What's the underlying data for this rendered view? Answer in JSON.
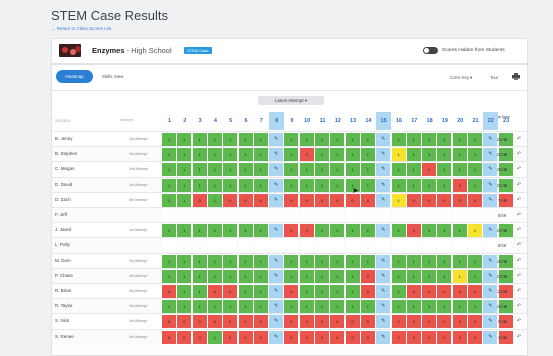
{
  "page": {
    "title": "STEM Case Results",
    "back_link": "← Return to Class Scores List"
  },
  "case": {
    "name": "Enzymes",
    "level": " - High School",
    "badge": "STEM Case"
  },
  "toggle_label": "Scores Hidden from Students",
  "tabs": [
    {
      "label": "Heatmap",
      "active": true
    },
    {
      "label": "Skills View",
      "active": false
    }
  ],
  "controls": {
    "color_key": "Color Key ▾",
    "tour": "Tour"
  },
  "attempt_select": "Latest Attempt ▾",
  "table": {
    "date": "2/1/2021",
    "attempts_header": "Attempts",
    "total_score_header": "Total Score",
    "questions": [
      "1",
      "2",
      "3",
      "4",
      "5",
      "6",
      "7",
      "8",
      "9",
      "10",
      "11",
      "12",
      "13",
      "14",
      "15",
      "16",
      "17",
      "18",
      "19",
      "20",
      "21",
      "22",
      "23"
    ],
    "rows": [
      {
        "name": "B. Jenny",
        "attempt": "3rd Attempt",
        "score": "26/49"
      },
      {
        "name": "B. Stephen",
        "attempt": "3rd Attempt",
        "score": "23/49"
      },
      {
        "name": "C. Megan",
        "attempt": "2nd Attempt",
        "score": "25/49"
      },
      {
        "name": "D. David",
        "attempt": "3rd Attempt",
        "score": "22/49"
      },
      {
        "name": "D. Zach",
        "attempt": "4th Attempt",
        "score": "7/49"
      },
      {
        "name": "F. Jeff",
        "attempt": "",
        "score": "0/49"
      },
      {
        "name": "J. Jared",
        "attempt": "1st Attempt",
        "score": "20/49"
      },
      {
        "name": "L. Polly",
        "attempt": "",
        "score": "0/49"
      },
      {
        "name": "M. Dom",
        "attempt": "3rd Attempt",
        "score": "26/49"
      },
      {
        "name": "P. Chase",
        "attempt": "3rd Attempt",
        "score": "24/49"
      },
      {
        "name": "R. Brian",
        "attempt": "4th Attempt",
        "score": "11/49"
      },
      {
        "name": "R. Taylor",
        "attempt": "3rd Attempt",
        "score": "26/49"
      },
      {
        "name": "S. Nick",
        "attempt": "3rd Attempt",
        "score": "0/49"
      },
      {
        "name": "S. Renee",
        "attempt": "4th Attempt",
        "score": "3/49"
      }
    ],
    "pencil_cols": [
      7,
      14,
      21
    ],
    "cells": [
      [
        "G",
        "G",
        "G",
        "G",
        "G",
        "G",
        "G",
        "P",
        "G",
        "G",
        "G",
        "G",
        "G",
        "G",
        "P",
        "G",
        "G",
        "G",
        "G",
        "G",
        "G",
        "P",
        "G"
      ],
      [
        "G",
        "G",
        "G",
        "G",
        "G",
        "G",
        "G",
        "P",
        "G",
        "R",
        "G",
        "G",
        "G",
        "G",
        "P",
        "Y",
        "G",
        "G",
        "G",
        "G",
        "G",
        "P",
        "G"
      ],
      [
        "G",
        "G",
        "G",
        "G",
        "G",
        "G",
        "G",
        "P",
        "G",
        "G",
        "G",
        "G",
        "G",
        "G",
        "P",
        "G",
        "G",
        "R",
        "G",
        "G",
        "G",
        "P",
        "G"
      ],
      [
        "G",
        "G",
        "G",
        "G",
        "G",
        "G",
        "G",
        "P",
        "G",
        "G",
        "G",
        "G",
        "G",
        "G",
        "P",
        "G",
        "G",
        "G",
        "G",
        "R",
        "G",
        "P",
        "G"
      ],
      [
        "G",
        "G",
        "R",
        "G",
        "R",
        "R",
        "R",
        "P",
        "R",
        "R",
        "R",
        "R",
        "R",
        "R",
        "P",
        "Y",
        "R",
        "R",
        "R",
        "R",
        "R",
        "P",
        "R"
      ],
      [
        "E",
        "E",
        "E",
        "E",
        "E",
        "E",
        "E",
        "E",
        "E",
        "E",
        "E",
        "E",
        "E",
        "E",
        "E",
        "E",
        "E",
        "E",
        "E",
        "E",
        "E",
        "E",
        "E"
      ],
      [
        "G",
        "G",
        "G",
        "G",
        "G",
        "G",
        "G",
        "P",
        "R",
        "R",
        "G",
        "G",
        "G",
        "G",
        "P",
        "G",
        "R",
        "G",
        "G",
        "G",
        "Y",
        "P",
        "G"
      ],
      [
        "E",
        "E",
        "E",
        "E",
        "E",
        "E",
        "E",
        "E",
        "E",
        "E",
        "E",
        "E",
        "E",
        "E",
        "E",
        "E",
        "E",
        "E",
        "E",
        "E",
        "E",
        "E",
        "E"
      ],
      [
        "G",
        "G",
        "G",
        "G",
        "G",
        "G",
        "G",
        "P",
        "G",
        "G",
        "G",
        "G",
        "G",
        "G",
        "P",
        "G",
        "G",
        "G",
        "G",
        "G",
        "G",
        "P",
        "G"
      ],
      [
        "G",
        "G",
        "G",
        "G",
        "G",
        "G",
        "G",
        "P",
        "G",
        "G",
        "G",
        "G",
        "G",
        "R",
        "P",
        "G",
        "G",
        "G",
        "G",
        "Y",
        "G",
        "P",
        "G"
      ],
      [
        "R",
        "G",
        "G",
        "R",
        "R",
        "G",
        "G",
        "P",
        "R",
        "G",
        "G",
        "G",
        "G",
        "R",
        "P",
        "G",
        "R",
        "R",
        "R",
        "R",
        "R",
        "P",
        "R"
      ],
      [
        "G",
        "G",
        "G",
        "G",
        "G",
        "G",
        "G",
        "P",
        "G",
        "G",
        "G",
        "G",
        "G",
        "G",
        "P",
        "G",
        "G",
        "G",
        "G",
        "G",
        "G",
        "P",
        "G"
      ],
      [
        "R",
        "R",
        "R",
        "R",
        "R",
        "R",
        "R",
        "P",
        "R",
        "R",
        "R",
        "R",
        "R",
        "R",
        "P",
        "R",
        "R",
        "R",
        "R",
        "R",
        "R",
        "P",
        "R"
      ],
      [
        "R",
        "R",
        "R",
        "G",
        "R",
        "R",
        "R",
        "P",
        "R",
        "R",
        "R",
        "R",
        "R",
        "R",
        "P",
        "R",
        "R",
        "R",
        "R",
        "R",
        "R",
        "P",
        "R"
      ]
    ]
  }
}
